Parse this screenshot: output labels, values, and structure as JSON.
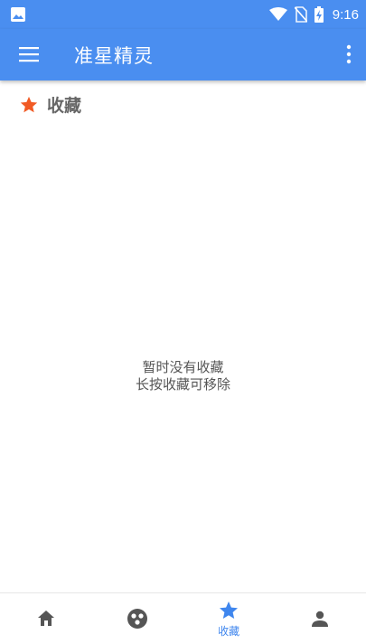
{
  "status_bar": {
    "time": "9:16"
  },
  "app_bar": {
    "title": "准星精灵"
  },
  "section": {
    "title": "收藏"
  },
  "empty_state": {
    "line1": "暂时没有收藏",
    "line2": "长按收藏可移除"
  },
  "bottom_nav": {
    "items": [
      {
        "icon": "home-icon",
        "label": "",
        "active": false
      },
      {
        "icon": "game-icon",
        "label": "",
        "active": false
      },
      {
        "icon": "star-icon",
        "label": "收藏",
        "active": true
      },
      {
        "icon": "person-icon",
        "label": "",
        "active": false
      }
    ]
  },
  "colors": {
    "primary": "#4a8ef0",
    "accent_star": "#f15a24",
    "active_nav": "#3f86ee",
    "inactive_nav": "#555555"
  }
}
